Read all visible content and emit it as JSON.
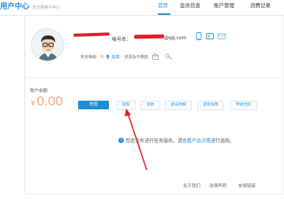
{
  "header": {
    "brand_title": "用户中心",
    "brand_sub": "吉方网用户中心",
    "nav": [
      "首页",
      "会员信息",
      "账户管理",
      "消费记录"
    ],
    "active_nav": "首页"
  },
  "profile": {
    "account_label": "帐号名：",
    "account_email": "@qq.com",
    "icons": [
      "phone-icon",
      "id-card-icon",
      "email-verify-icon"
    ]
  },
  "security": {
    "label": "安全等级:",
    "level": "中",
    "upgrade": "提高",
    "assets": "资源永不释放"
  },
  "balance": {
    "label": "账户余额:",
    "currency": "¥",
    "amount": "0.00",
    "recharge": "充值"
  },
  "actions": [
    "提现",
    "退款",
    "收支明细",
    "索取发票",
    "申请合同"
  ],
  "notice": {
    "prefix": "您还没有进行任务服务。请",
    "link": "查看产品详情",
    "suffix": "进行选购。"
  },
  "footer": [
    "关于我们",
    "法律声明",
    "友情链接"
  ],
  "colors": {
    "accent": "#2a8fd6",
    "balance": "#f3a77b",
    "annotation": "#e01f2b"
  }
}
